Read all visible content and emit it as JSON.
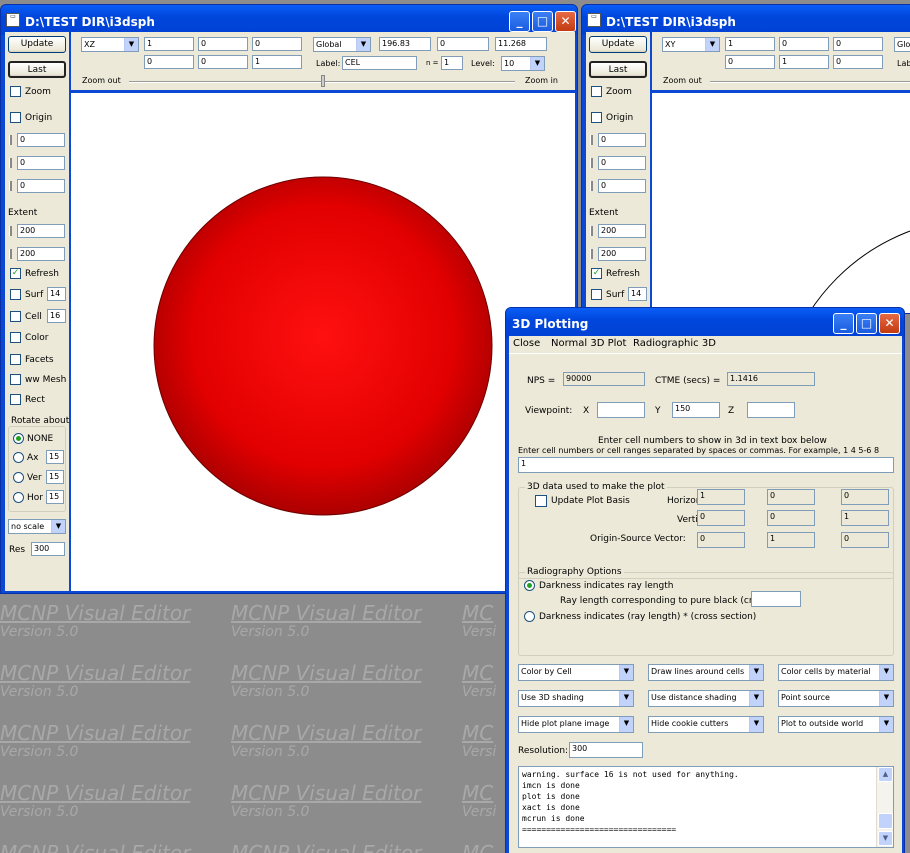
{
  "watermark": {
    "title": "MCNP Visual Editor",
    "version": "Version 5.0",
    "cropped_title": "MC",
    "cropped_version": "Versi"
  },
  "win1": {
    "title": "D:\\TEST DIR\\i3dsph",
    "update": "Update",
    "last": "Last",
    "zoom": "Zoom",
    "origin": "Origin",
    "origin_vals": [
      "0",
      "0",
      "0"
    ],
    "extent": "Extent",
    "extent_vals": [
      "200",
      "200"
    ],
    "refresh": "Refresh",
    "surf": "Surf",
    "surf_val": "14",
    "cell": "Cell",
    "cell_val": "16",
    "color": "Color",
    "facets": "Facets",
    "wwmesh": "ww Mesh",
    "rect": "Rect",
    "rotate_about": "Rotate about",
    "none": "NONE",
    "ax": "Ax",
    "ax_val": "15",
    "ver": "Ver",
    "ver_val": "15",
    "hor": "Hor",
    "hor_val": "15",
    "scale": "no scale",
    "res": "Res",
    "res_val": "300",
    "plane": "XZ",
    "row1": [
      "1",
      "0",
      "0"
    ],
    "row2": [
      "0",
      "0",
      "1"
    ],
    "coord": "Global",
    "c1": "196.83",
    "c2": "0",
    "c3": "11.268",
    "label": "Label:",
    "label_val": "CEL",
    "n": "n =",
    "n_val": "1",
    "level": "Level:",
    "level_val": "10",
    "zoom_out": "Zoom out",
    "zoom_in": "Zoom in",
    "sphere_color": "#e60000"
  },
  "win2": {
    "title": "D:\\TEST DIR\\i3dsph",
    "update": "Update",
    "last": "Last",
    "zoom": "Zoom",
    "origin": "Origin",
    "origin_vals": [
      "0",
      "0",
      "0"
    ],
    "extent": "Extent",
    "extent_vals": [
      "200",
      "200"
    ],
    "refresh": "Refresh",
    "surf": "Surf",
    "surf_val": "14",
    "plane": "XY",
    "row1": [
      "1",
      "0",
      "0"
    ],
    "row2": [
      "0",
      "1",
      "0"
    ],
    "coord": "Glo",
    "lab": "Lab",
    "zoom_out": "Zoom out"
  },
  "plot3d": {
    "title": "3D Plotting",
    "menu": [
      "Close",
      "Normal 3D Plot",
      "Radiographic 3D"
    ],
    "nps_label": "NPS =",
    "nps": "90000",
    "ctme_label": "CTME (secs) =",
    "ctme": "1.1416",
    "viewpoint": "Viewpoint:",
    "x": "X",
    "x_val": "",
    "y": "Y",
    "y_val": "150",
    "z": "Z",
    "z_val": "",
    "cell_text1": "Enter cell numbers to show in 3d in text box below",
    "cell_text2": "Enter cell numbers or cell ranges separated by spaces or commas.  For example, 1 4 5-6 8",
    "cells": "1",
    "data_group": "3D data used to make the plot",
    "update_basis": "Update Plot Basis",
    "horizontal": "Horizontal",
    "h_vals": [
      "1",
      "0",
      "0"
    ],
    "vertical": "Vertical",
    "v_vals": [
      "0",
      "0",
      "1"
    ],
    "osv": "Origin-Source Vector:",
    "osv_vals": [
      "0",
      "1",
      "0"
    ],
    "radio_group": "Radiography Options",
    "dark_len": "Darkness indicates ray length",
    "ray_len": "Ray length corresponding to pure black (cm)",
    "dark_cs": "Darkness indicates (ray length) * (cross section)",
    "selects": [
      "Color by Cell",
      "Draw lines around cells",
      "Color cells by material",
      "Use 3D shading",
      "Use distance shading",
      "Point source",
      "Hide plot plane image",
      "Hide cookie cutters",
      "Plot to outside world"
    ],
    "resolution": "Resolution:",
    "res_val": "300",
    "log": [
      "warning. surface    16 is not used for anything.",
      "imcn    is done",
      "plot    is done",
      "xact    is done",
      "mcrun    is done",
      "================================"
    ]
  }
}
